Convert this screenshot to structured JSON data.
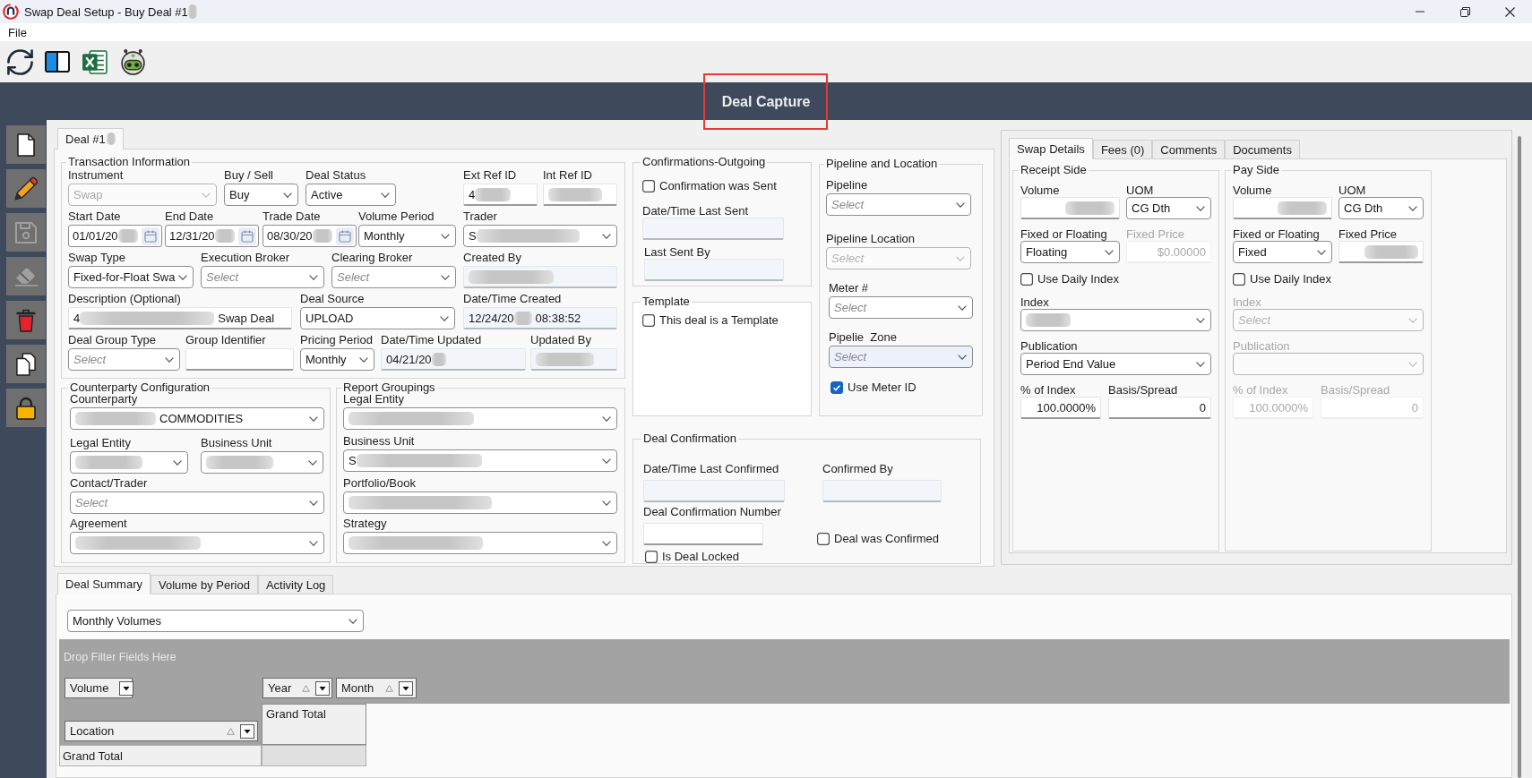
{
  "window": {
    "title": "Swap Deal Setup - Buy Deal #1",
    "redacted": true
  },
  "menu": [
    {
      "label": "File"
    }
  ],
  "sidebar": [
    {
      "disabled": false
    },
    {
      "disabled": false
    },
    {
      "disabled": true
    },
    {
      "disabled": true
    },
    {
      "disabled": false
    },
    {
      "disabled": false
    },
    {
      "disabled": false
    }
  ],
  "header": {
    "title": "Deal Capture",
    "highlighted": true
  },
  "deal_tabs": [
    {
      "label": "Deal #1",
      "redacted": true,
      "selected": true
    }
  ],
  "transaction": {
    "title": "Transaction Information",
    "fields": [
      {
        "label": "Instrument",
        "kind": "select",
        "value": "Swap",
        "disabled": true
      },
      {
        "label": "Buy / Sell",
        "kind": "select",
        "value": "Buy"
      },
      {
        "label": "Deal Status",
        "kind": "select",
        "value": "Active"
      },
      {
        "label": "Ext Ref ID",
        "kind": "input",
        "value": "4",
        "redacted": true
      },
      {
        "label": "Int Ref ID",
        "kind": "input",
        "redacted": true
      },
      {
        "label": "Start Date",
        "kind": "date",
        "value": "01/01/20",
        "redacted": true
      },
      {
        "label": "End Date",
        "kind": "date",
        "value": "12/31/20",
        "redacted": true
      },
      {
        "label": "Trade Date",
        "kind": "date",
        "value": "08/30/20",
        "redacted": true
      },
      {
        "label": "Volume Period",
        "kind": "select",
        "value": "Monthly"
      },
      {
        "label": "Trader",
        "kind": "select",
        "value": "S",
        "redacted": true
      },
      {
        "label": "Swap Type",
        "kind": "select",
        "value": "Fixed-for-Float Swa"
      },
      {
        "label": "Execution Broker",
        "kind": "select",
        "placeholder": "Select"
      },
      {
        "label": "Clearing Broker",
        "kind": "select",
        "placeholder": "Select"
      },
      {
        "label": "Created By",
        "kind": "readonly",
        "redacted": true
      },
      {
        "label": "Description (Optional)",
        "kind": "input",
        "value": "4",
        "redacted": true,
        "value_after": "Swap Deal"
      },
      {
        "label": "Deal Source",
        "kind": "select",
        "value": "UPLOAD"
      },
      {
        "label": "Date/Time Created",
        "kind": "readonly",
        "value": "12/24/20",
        "redacted": true,
        "value_after": "08:38:52"
      },
      {
        "label": "Deal Group Type",
        "kind": "select",
        "placeholder": "Select"
      },
      {
        "label": "Group Identifier",
        "kind": "input"
      },
      {
        "label": "Pricing Period",
        "kind": "select",
        "value": "Monthly"
      },
      {
        "label": "Date/Time Updated",
        "kind": "readonly",
        "value": "04/21/20",
        "redacted": true
      },
      {
        "label": "Updated By",
        "kind": "readonly",
        "redacted": true
      }
    ]
  },
  "counterparty": {
    "title": "Counterparty Configuration",
    "fields": [
      {
        "label": "Counterparty",
        "kind": "select",
        "redacted": true,
        "value_after": "COMMODITIES"
      },
      {
        "label": "Legal Entity",
        "kind": "select",
        "redacted": true
      },
      {
        "label": "Business Unit",
        "kind": "select",
        "redacted": true
      },
      {
        "label": "Contact/Trader",
        "kind": "select",
        "placeholder": "Select"
      },
      {
        "label": "Agreement",
        "kind": "select",
        "redacted": true
      }
    ]
  },
  "report_groupings": {
    "title": "Report Groupings",
    "fields": [
      {
        "label": "Legal Entity",
        "kind": "select",
        "redacted": true
      },
      {
        "label": "Business Unit",
        "kind": "select",
        "value": "S",
        "redacted": true
      },
      {
        "label": "Portfolio/Book",
        "kind": "select",
        "redacted": true
      },
      {
        "label": "Strategy",
        "kind": "select",
        "redacted": true
      }
    ]
  },
  "confirmations_outgoing": {
    "title": "Confirmations-Outgoing",
    "fields": [
      {
        "label": "Confirmation was Sent",
        "kind": "checkbox",
        "checked": false
      },
      {
        "label": "Date/Time Last Sent",
        "kind": "readonly"
      },
      {
        "label": "Last Sent By",
        "kind": "readonly"
      }
    ]
  },
  "template": {
    "title": "Template",
    "fields": [
      {
        "label": "This deal is a Template",
        "kind": "checkbox",
        "checked": false
      }
    ]
  },
  "pipeline": {
    "title": "Pipeline and Location",
    "fields": [
      {
        "label": "Pipeline",
        "kind": "select",
        "placeholder": "Select"
      },
      {
        "label": "Pipeline Location",
        "kind": "select",
        "placeholder": "Select",
        "disabled": true
      },
      {
        "label": "Meter #",
        "kind": "select",
        "placeholder": "Select"
      },
      {
        "label": "Pipelie  Zone",
        "kind": "select",
        "placeholder": "Select",
        "focused": true
      },
      {
        "label": "Use Meter ID",
        "kind": "checkbox",
        "checked": true
      }
    ]
  },
  "deal_confirmation": {
    "title": "Deal Confirmation",
    "fields": [
      {
        "label": "Date/Time Last Confirmed",
        "kind": "readonly"
      },
      {
        "label": "Confirmed By",
        "kind": "readonly"
      },
      {
        "label": "Deal Confirmation Number",
        "kind": "input"
      },
      {
        "label": "Deal was Confirmed",
        "kind": "checkbox",
        "checked": false
      },
      {
        "label": "Is Deal Locked",
        "kind": "checkbox",
        "checked": false
      }
    ]
  },
  "swap_tabs": [
    {
      "label": "Swap Details",
      "selected": true
    },
    {
      "label": "Fees (0)",
      "selected": false
    },
    {
      "label": "Comments",
      "selected": false
    },
    {
      "label": "Documents",
      "selected": false
    }
  ],
  "swap_sides": [
    {
      "title": "Receipt Side",
      "fields": [
        {
          "label": "Volume",
          "kind": "number",
          "redacted": true
        },
        {
          "label": "UOM",
          "kind": "select",
          "value": "CG Dth"
        },
        {
          "label": "Fixed or Floating",
          "kind": "select",
          "value": "Floating"
        },
        {
          "label": "Fixed Price",
          "kind": "number",
          "value": "$0.00000",
          "disabled": true
        },
        {
          "label": "Use Daily Index",
          "kind": "checkbox",
          "checked": false
        },
        {
          "label": "Index",
          "kind": "select",
          "redacted": true
        },
        {
          "label": "Publication",
          "kind": "select",
          "value": "Period End Value"
        },
        {
          "label": "% of Index",
          "kind": "number",
          "value": "100.0000%"
        },
        {
          "label": "Basis/Spread",
          "kind": "number",
          "value": "0"
        }
      ]
    },
    {
      "title": "Pay Side",
      "fields": [
        {
          "label": "Volume",
          "kind": "number",
          "redacted": true
        },
        {
          "label": "UOM",
          "kind": "select",
          "value": "CG Dth"
        },
        {
          "label": "Fixed or Floating",
          "kind": "select",
          "value": "Fixed"
        },
        {
          "label": "Fixed Price",
          "kind": "number",
          "redacted": true
        },
        {
          "label": "Use Daily Index",
          "kind": "checkbox",
          "checked": false
        },
        {
          "label": "Index",
          "kind": "select",
          "placeholder": "Select",
          "disabled": true
        },
        {
          "label": "Publication",
          "kind": "select",
          "disabled": true
        },
        {
          "label": "% of Index",
          "kind": "number",
          "value": "100.0000%",
          "disabled": true
        },
        {
          "label": "Basis/Spread",
          "kind": "number",
          "value": "0",
          "disabled": true
        }
      ]
    }
  ],
  "summary_tabs": [
    {
      "label": "Deal Summary",
      "selected": true
    },
    {
      "label": "Volume by Period",
      "selected": false
    },
    {
      "label": "Activity Log",
      "selected": false
    }
  ],
  "summary": {
    "view": {
      "kind": "select",
      "value": "Monthly Volumes"
    },
    "filter_hint": "Drop Filter Fields Here",
    "data_fields": [
      {
        "label": "Volume",
        "sorted": false
      }
    ],
    "column_fields": [
      {
        "label": "Year",
        "sorted": true
      },
      {
        "label": "Month",
        "sorted": true
      }
    ],
    "row_fields": [
      {
        "label": "Location",
        "sorted": true
      }
    ],
    "column_total": "Grand Total",
    "row_total": "Grand Total"
  }
}
